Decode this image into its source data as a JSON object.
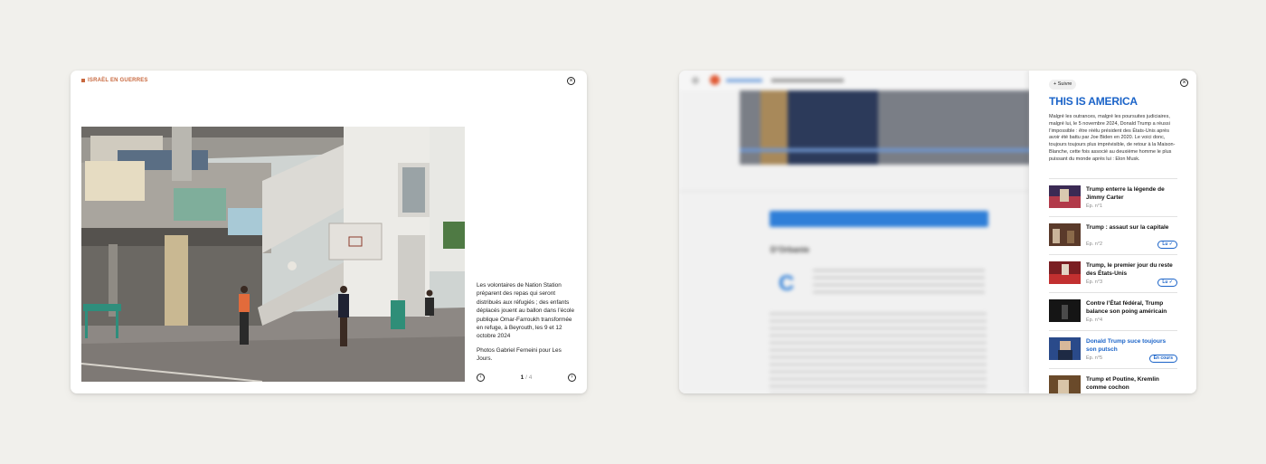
{
  "left_card": {
    "kicker": "ISRAËL EN GUERRES",
    "caption": "Les volontaires de Nation Station préparent des repas qui seront distribués aux réfugiés ; des enfants déplacés jouent au ballon dans l’école publique Omar-Farroukh transformée en refuge, à Beyrouth, les 9 et 12 octobre 2024",
    "credit": "Photos Gabriel Ferneini pour Les Jours.",
    "counter_current": "1",
    "counter_total": "/ 4",
    "icons": {
      "close": "×",
      "prev": "‹",
      "next": "›"
    }
  },
  "right_card": {
    "follow_label": "+ Suivre",
    "series_title": "THIS IS AMERICA",
    "series_description": "Malgré les outrances, malgré les poursuites judiciaires, malgré lui, le 5 novembre 2024, Donald Trump a réussi l’impossible : être réélu président des États-Unis après avoir été battu par Joe Biden en 2020. Le voici donc, toujours toujours plus imprévisible, de retour à la Maison-Blanche, cette fois associé au deuxième homme le plus puissant du monde après lui : Elon Musk.",
    "episodes": [
      {
        "title": "Trump enterre la légende de Jimmy Carter",
        "num": "Ép. n°1",
        "badge": ""
      },
      {
        "title": "Trump : assaut sur la capitale",
        "num": "Ép. n°2",
        "badge": "Lu ✓"
      },
      {
        "title": "Trump, le premier jour du reste des États-Unis",
        "num": "Ép. n°3",
        "badge": "Lu ✓"
      },
      {
        "title": "Contre l’État fédéral, Trump balance son poing américain",
        "num": "Ép. n°4",
        "badge": ""
      },
      {
        "title": "Donald Trump suce toujours son putsch",
        "num": "Ép. n°5",
        "badge": "En cours"
      },
      {
        "title": "Trump et Poutine, Kremlin comme cochon",
        "num": "",
        "badge": ""
      }
    ],
    "blurred": {
      "subtitle": "D’Orbanie",
      "dropcap": "C"
    },
    "colors": {
      "accent": "#1a63c8",
      "kicker": "#c8683e"
    }
  }
}
